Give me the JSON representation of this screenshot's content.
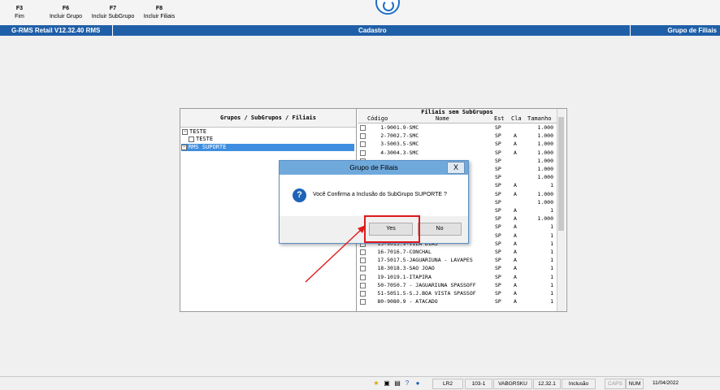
{
  "toolbar": {
    "keys": [
      {
        "key": "F3",
        "label": "Fim"
      },
      {
        "key": "F6",
        "label": "Incluir Grupo"
      },
      {
        "key": "F7",
        "label": "Incluir SubGrupo"
      },
      {
        "key": "F8",
        "label": "Incluir Filiais"
      }
    ]
  },
  "titlebar": {
    "app": "G-RMS Retail V12.32.40 RMS",
    "screen": "Cadastro",
    "section": "Grupo de Filiais"
  },
  "tree": {
    "header": "Grupos / SubGrupos / Filiais",
    "nodes": [
      {
        "label": "TESTE",
        "marker": "−"
      },
      {
        "label": "TESTE",
        "marker": ""
      },
      {
        "label": "RMS SUPORTE",
        "marker": "−"
      }
    ]
  },
  "filiais": {
    "header": "Filiais sem SubGrupos",
    "columns": {
      "codigo": "Código",
      "nome": "Nome",
      "est": "Est",
      "cla": "Cla",
      "tamanho": "Tamanho"
    },
    "rows": [
      {
        "codigo": "1-9",
        "nome": "001.9-SMC",
        "est": "SP",
        "cla": "",
        "tamanho": "1.000"
      },
      {
        "codigo": "2-7",
        "nome": "002.7-SMC",
        "est": "SP",
        "cla": "A",
        "tamanho": "1.000"
      },
      {
        "codigo": "3-5",
        "nome": "003.5-SMC",
        "est": "SP",
        "cla": "A",
        "tamanho": "1.000"
      },
      {
        "codigo": "4-3",
        "nome": "004.3-SMC",
        "est": "SP",
        "cla": "A",
        "tamanho": "1.000"
      },
      {
        "codigo": "",
        "nome": "",
        "est": "SP",
        "cla": "",
        "tamanho": "1.000"
      },
      {
        "codigo": "",
        "nome": "",
        "est": "SP",
        "cla": "",
        "tamanho": "1.000"
      },
      {
        "codigo": "",
        "nome": "",
        "est": "SP",
        "cla": "",
        "tamanho": "1.000"
      },
      {
        "codigo": "",
        "nome": "",
        "est": "SP",
        "cla": "A",
        "tamanho": "1"
      },
      {
        "codigo": "",
        "nome": "",
        "est": "SP",
        "cla": "A",
        "tamanho": "1.000"
      },
      {
        "codigo": "",
        "nome": "",
        "est": "SP",
        "cla": "",
        "tamanho": "1.000"
      },
      {
        "codigo": "",
        "nome": "",
        "est": "SP",
        "cla": "A",
        "tamanho": "1"
      },
      {
        "codigo": "",
        "nome": "",
        "est": "SP",
        "cla": "A",
        "tamanho": "1.000"
      },
      {
        "codigo": "",
        "nome": "",
        "est": "SP",
        "cla": "A",
        "tamanho": "1"
      },
      {
        "codigo": "",
        "nome": "",
        "est": "SP",
        "cla": "A",
        "tamanho": "1"
      },
      {
        "codigo": "15-9",
        "nome": "015.9-VILA DIAS",
        "est": "SP",
        "cla": "A",
        "tamanho": "1"
      },
      {
        "codigo": "16-7",
        "nome": "016.7-CONCHAL",
        "est": "SP",
        "cla": "A",
        "tamanho": "1"
      },
      {
        "codigo": "17-5",
        "nome": "017.5-JAGUARIUNA - LAVAPES",
        "est": "SP",
        "cla": "A",
        "tamanho": "1"
      },
      {
        "codigo": "18-3",
        "nome": "018.3-SAO JOAO",
        "est": "SP",
        "cla": "A",
        "tamanho": "1"
      },
      {
        "codigo": "19-1",
        "nome": "019.1-ITAPIRA",
        "est": "SP",
        "cla": "A",
        "tamanho": "1"
      },
      {
        "codigo": "50-7",
        "nome": "050.7 - JAGUARIUNA SPASSOFF",
        "est": "SP",
        "cla": "A",
        "tamanho": "1"
      },
      {
        "codigo": "51-5",
        "nome": "051.5-S.J.BOA VISTA SPASSOF",
        "est": "SP",
        "cla": "A",
        "tamanho": "1"
      },
      {
        "codigo": "80-9",
        "nome": "080.9 - ATACADO",
        "est": "SP",
        "cla": "A",
        "tamanho": "1"
      }
    ]
  },
  "dialog": {
    "title": "Grupo de Filiais",
    "close": "X",
    "message": "Você Confirma a Inclusão do SubGrupo SUPORTE ?",
    "yes": "Yes",
    "no": "No"
  },
  "status": {
    "fields": [
      "LR2",
      "103-1",
      "VABGRSKU",
      "12.32.1",
      "Inclusão",
      "CAPS",
      "NUM",
      "11/04/2022"
    ]
  },
  "colors": {
    "titlebar": "#1f5fa8",
    "dialog_title": "#6fa9dc",
    "selection": "#3d8ee0",
    "highlight": "#e01818"
  }
}
